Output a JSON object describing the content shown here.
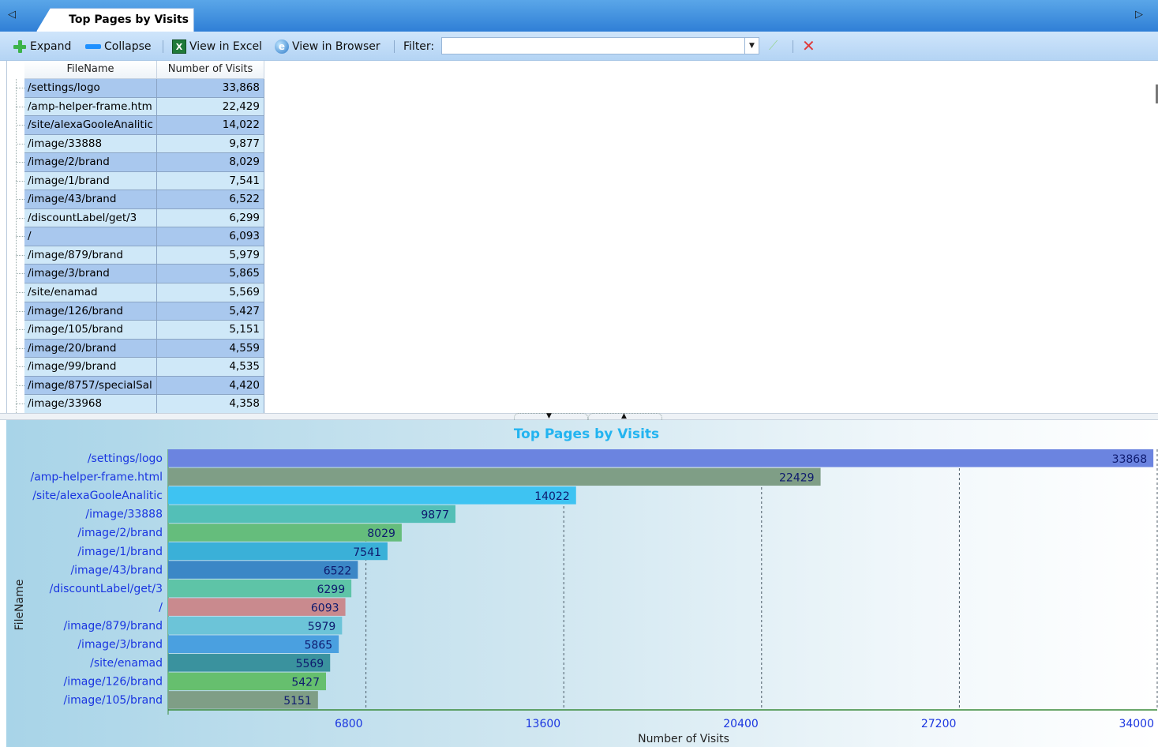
{
  "tab": {
    "title": "Top Pages by Visits",
    "left_arrow": "◁",
    "right_arrow": "▷"
  },
  "toolbar": {
    "expand_label": "Expand",
    "collapse_label": "Collapse",
    "excel_label": "View in Excel",
    "browser_label": "View in Browser",
    "filter_label": "Filter:",
    "filter_value": ""
  },
  "grid": {
    "columns": [
      "FileName",
      "Number of Visits"
    ],
    "rows": [
      {
        "name": "/settings/logo",
        "visits": "33,868"
      },
      {
        "name": "/amp-helper-frame.htm",
        "visits": "22,429"
      },
      {
        "name": "/site/alexaGooleAnalitic",
        "visits": "14,022"
      },
      {
        "name": "/image/33888",
        "visits": "9,877"
      },
      {
        "name": "/image/2/brand",
        "visits": "8,029"
      },
      {
        "name": "/image/1/brand",
        "visits": "7,541"
      },
      {
        "name": "/image/43/brand",
        "visits": "6,522"
      },
      {
        "name": "/discountLabel/get/3",
        "visits": "6,299"
      },
      {
        "name": "/",
        "visits": "6,093"
      },
      {
        "name": "/image/879/brand",
        "visits": "5,979"
      },
      {
        "name": "/image/3/brand",
        "visits": "5,865"
      },
      {
        "name": "/site/enamad",
        "visits": "5,569"
      },
      {
        "name": "/image/126/brand",
        "visits": "5,427"
      },
      {
        "name": "/image/105/brand",
        "visits": "5,151"
      },
      {
        "name": "/image/20/brand",
        "visits": "4,559"
      },
      {
        "name": "/image/99/brand",
        "visits": "4,535"
      },
      {
        "name": "/image/8757/specialSal",
        "visits": "4,420"
      },
      {
        "name": "/image/33968",
        "visits": "4,358"
      }
    ]
  },
  "chart_data": {
    "type": "bar",
    "orientation": "horizontal",
    "title": "Top Pages by Visits",
    "xlabel": "Number of Visits",
    "ylabel": "FileName",
    "xlim": [
      0,
      34000
    ],
    "xticks": [
      6800,
      13600,
      20400,
      27200,
      34000
    ],
    "grid": "vertical dashed",
    "categories": [
      "/settings/logo",
      "/amp-helper-frame.html",
      "/site/alexaGooleAnalitic",
      "/image/33888",
      "/image/2/brand",
      "/image/1/brand",
      "/image/43/brand",
      "/discountLabel/get/3",
      "/",
      "/image/879/brand",
      "/image/3/brand",
      "/site/enamad",
      "/image/126/brand",
      "/image/105/brand"
    ],
    "values": [
      33868,
      22429,
      14022,
      9877,
      8029,
      7541,
      6522,
      6299,
      6093,
      5979,
      5865,
      5569,
      5427,
      5151
    ],
    "colors": [
      "#6b84e0",
      "#7f9e86",
      "#3ec3f2",
      "#53bfb7",
      "#65bd7c",
      "#3ab0d8",
      "#3b87c6",
      "#5ec4a7",
      "#c98a8e",
      "#6cc4d8",
      "#4aa0e0",
      "#3a929e",
      "#66bf6e",
      "#7f9e86"
    ]
  }
}
